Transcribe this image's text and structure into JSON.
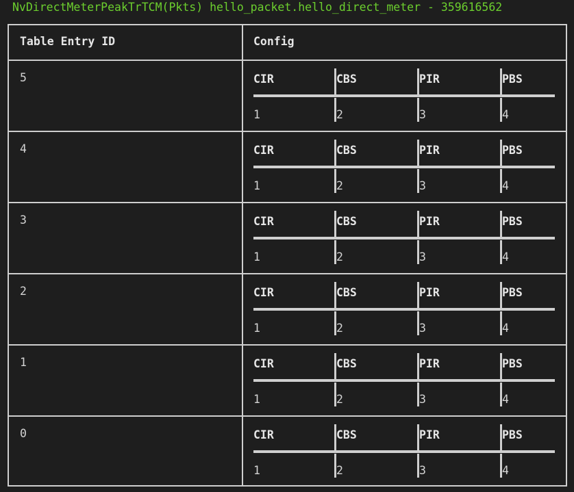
{
  "title": "NvDirectMeterPeakTrTCM(Pkts) hello_packet.hello_direct_meter - 359616562",
  "table": {
    "headers": [
      "Table Entry ID",
      "Config"
    ],
    "config_columns": [
      "CIR",
      "CBS",
      "PIR",
      "PBS"
    ],
    "rows": [
      {
        "id": "5",
        "values": [
          "1",
          "2",
          "3",
          "4"
        ]
      },
      {
        "id": "4",
        "values": [
          "1",
          "2",
          "3",
          "4"
        ]
      },
      {
        "id": "3",
        "values": [
          "1",
          "2",
          "3",
          "4"
        ]
      },
      {
        "id": "2",
        "values": [
          "1",
          "2",
          "3",
          "4"
        ]
      },
      {
        "id": "1",
        "values": [
          "1",
          "2",
          "3",
          "4"
        ]
      },
      {
        "id": "0",
        "values": [
          "1",
          "2",
          "3",
          "4"
        ]
      }
    ]
  }
}
